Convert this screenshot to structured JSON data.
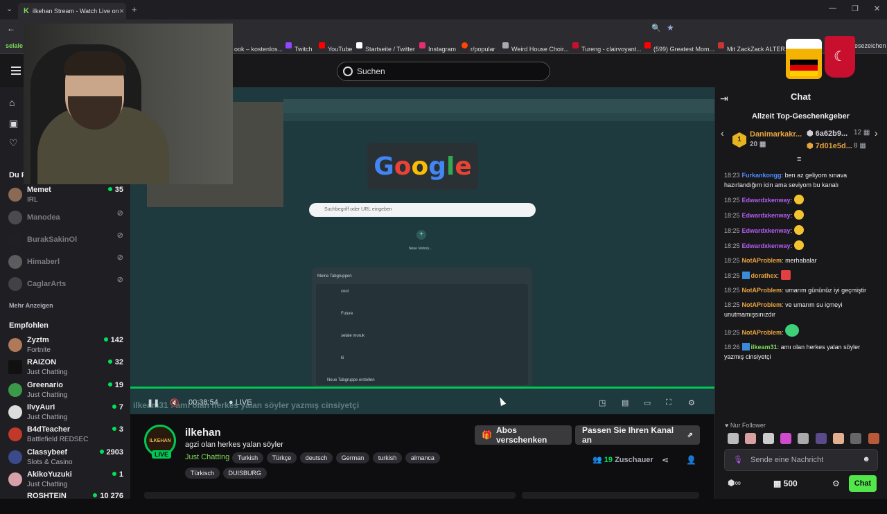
{
  "browser": {
    "tab_title": "ilkehan Stream - Watch Live on",
    "tab_favicon": "K",
    "bookmarks": [
      {
        "label": "ook – kostenlos...",
        "color": "#888"
      },
      {
        "label": "Twitch",
        "color": "#9146ff"
      },
      {
        "label": "YouTube",
        "color": "#ff0000"
      },
      {
        "label": "Startseite / Twitter",
        "color": "#ffffff"
      },
      {
        "label": "Instagram",
        "color": "#e1306c"
      },
      {
        "label": "r/popular",
        "color": "#ff4500"
      },
      {
        "label": "Weird House Choir...",
        "color": "#aaaaaa"
      },
      {
        "label": "Tureng - clairvoyant...",
        "color": "#c8102e"
      },
      {
        "label": "(599) Greatest Mom...",
        "color": "#ff0000"
      },
      {
        "label": "Mit ZackZack ALTER...",
        "color": "#cc3333"
      },
      {
        "label": "Lesezeichen",
        "color": "#888"
      }
    ],
    "bm_left": "selale m"
  },
  "nav": {
    "search_placeholder": "Suchen"
  },
  "sidebar": {
    "followed_heading": "Du F",
    "followed": [
      {
        "name": "Memet",
        "game": "IRL",
        "viewers": "35",
        "online": true
      },
      {
        "name": "Manodea",
        "online": false
      },
      {
        "name": "BurakSakinOl",
        "online": false
      },
      {
        "name": "Himaberl",
        "online": false
      },
      {
        "name": "CaglarArts",
        "online": false
      }
    ],
    "show_more": "Mehr Anzeigen",
    "recommended_heading": "Empfohlen",
    "recommended": [
      {
        "name": "Zyztm",
        "game": "Fortnite",
        "viewers": "142"
      },
      {
        "name": "RAIZON",
        "game": "Just Chatting",
        "viewers": "32"
      },
      {
        "name": "Greenario",
        "game": "Just Chatting",
        "viewers": "19"
      },
      {
        "name": "IlvyAuri",
        "game": "Just Chatting",
        "viewers": "7"
      },
      {
        "name": "B4dTeacher",
        "game": "Battlefield REDSEC",
        "viewers": "3"
      },
      {
        "name": "Classybeef",
        "game": "Slots & Casino",
        "viewers": "2903"
      },
      {
        "name": "AkikoYuzuki",
        "game": "Just Chatting",
        "viewers": "1"
      },
      {
        "name": "ROSHTEIN",
        "game": "",
        "viewers": "10 276"
      }
    ]
  },
  "player": {
    "inner_search_placeholder": "Suchbegriff oder URL eingeben",
    "inner_new_shortcut": "Neue Verknü...",
    "inner_tabgroups_title": "Meine Tabgruppen",
    "inner_tabgroups": [
      "cool",
      "Future",
      "selale moruk",
      "ki"
    ],
    "inner_tabgroups_footer": "Neue Tabgruppe erstellen",
    "overlay_chat": "ilkeam31 : amı olan herkes yalan söyler yazmış cinsiyetçi",
    "time": "00:38:54",
    "live": "LIVE"
  },
  "stream": {
    "streamer": "ilkehan",
    "avatar_text": "ILKEHAN",
    "live_badge": "LIVE",
    "title": "agzi olan herkes yalan söyler",
    "game": "Just Chatting",
    "tags": [
      "Turkish",
      "Türkçe",
      "deutsch",
      "German",
      "turkish",
      "almanca"
    ],
    "tags2": [
      "Türkisch",
      "DUISBURG"
    ],
    "gift_button": "Abos verschenken",
    "customize_button": "Passen Sie Ihren Kanal an",
    "viewers_count": "19",
    "viewers_label": "Zuschauer"
  },
  "chat": {
    "title": "Chat",
    "top_gifters_title": "Allzeit Top-Geschenkgeber",
    "gifter1_name": "Danimarkakr...",
    "gifter1_rank": "1",
    "gifter1_count": "20",
    "gifter2_name": "6a62b9...",
    "gifter2_count": "12",
    "gifter3_name": "7d01e5d...",
    "gifter3_count": "8",
    "messages": [
      {
        "time": "18:23",
        "user": "Furkankongg",
        "color": "#4f8cff",
        "text": "ben az geliyom sınava hazırlandığım icin ama seviyom bu kanalı",
        "emote": ""
      },
      {
        "time": "18:25",
        "user": "Edwardxkenway",
        "color": "#b45cf0",
        "text": "",
        "emote": "#f4c430"
      },
      {
        "time": "18:25",
        "user": "Edwardxkenway",
        "color": "#b45cf0",
        "text": "",
        "emote": "#f4c430"
      },
      {
        "time": "18:25",
        "user": "Edwardxkenway",
        "color": "#b45cf0",
        "text": "",
        "emote": "#f4c430"
      },
      {
        "time": "18:25",
        "user": "Edwardxkenway",
        "color": "#b45cf0",
        "text": "",
        "emote": "#f4c430"
      },
      {
        "time": "18:25",
        "user": "NotAProblem",
        "color": "#e8a33d",
        "text": "merhabalar",
        "emote": ""
      },
      {
        "time": "18:25",
        "user": "dorathex",
        "color": "#e8a33d",
        "text": "",
        "emote": "#e04040"
      },
      {
        "time": "18:25",
        "user": "NotAProblem",
        "color": "#e8a33d",
        "text": "umarım gününüz iyi geçmiştir",
        "emote": ""
      },
      {
        "time": "18:25",
        "user": "NotAProblem",
        "color": "#e8a33d",
        "text": "ve umarım su içmeyi unutmamışsınızdır",
        "emote": ""
      },
      {
        "time": "18:25",
        "user": "NotAProblem",
        "color": "#e8a33d",
        "text": "",
        "emote": "#3fd07a"
      },
      {
        "time": "18:26",
        "user": "ilkeam31",
        "color": "#7fd858",
        "text": "amı olan herkes yalan söyler yazmış cinsiyetçi",
        "emote": ""
      }
    ],
    "follower_only": "Nur Follower",
    "input_placeholder": "Sende eine Nachricht",
    "points": "500",
    "chat_button": "Chat"
  }
}
